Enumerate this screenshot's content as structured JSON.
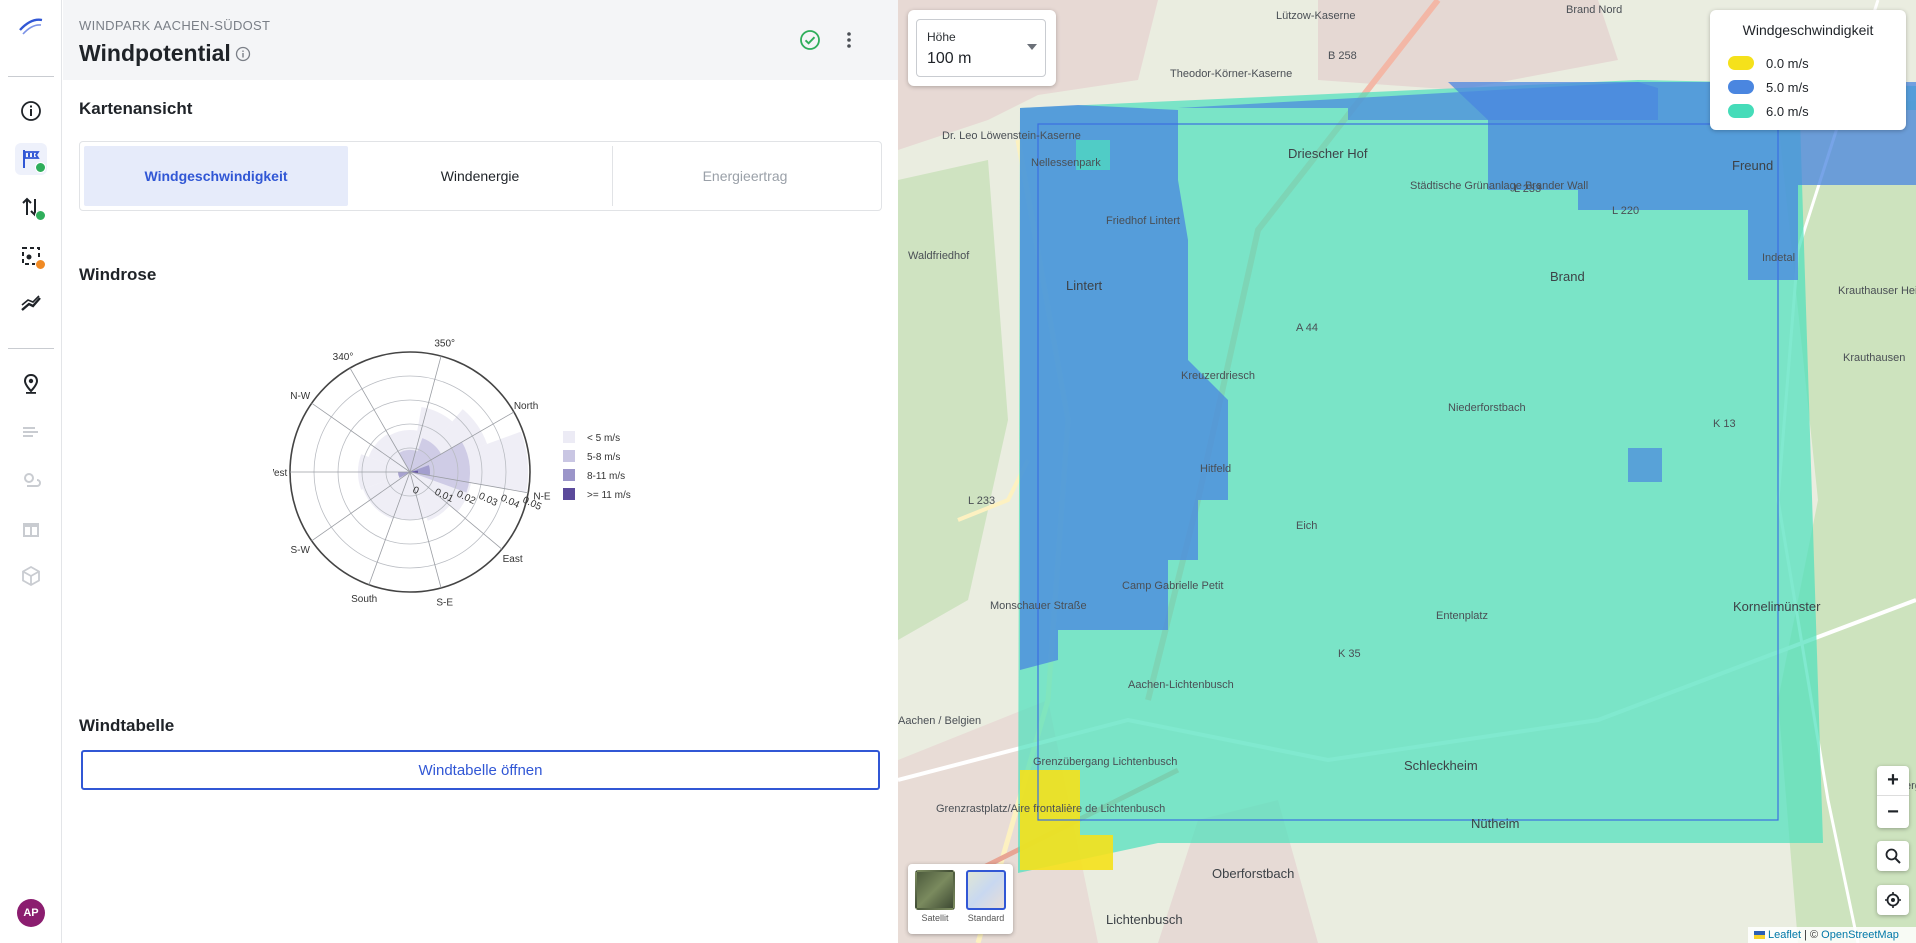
{
  "header": {
    "project_name": "WINDPARK AACHEN-SÜDOST",
    "title": "Windpotential"
  },
  "sidebar": {
    "avatar_initials": "AP",
    "items": [
      {
        "icon": "info-icon"
      },
      {
        "icon": "wind-flag-icon",
        "badge": "green",
        "active": true
      },
      {
        "icon": "turbine-transfer-icon",
        "badge": "green"
      },
      {
        "icon": "area-select-icon",
        "badge": "orange"
      },
      {
        "icon": "transmission-icon"
      },
      {
        "icon": "location-pin-icon"
      },
      {
        "icon": "wind-lines-icon",
        "disabled": true
      },
      {
        "icon": "sun-cloud-icon",
        "disabled": true
      },
      {
        "icon": "gift-icon",
        "disabled": true
      },
      {
        "icon": "cube-icon",
        "disabled": true
      }
    ]
  },
  "kartenansicht": {
    "title": "Kartenansicht",
    "tabs": [
      {
        "label": "Windgeschwindigkeit",
        "state": "active"
      },
      {
        "label": "Windenergie",
        "state": "normal"
      },
      {
        "label": "Energieertrag",
        "state": "disabled"
      }
    ]
  },
  "windrose": {
    "title": "Windrose",
    "direction_labels": [
      "340°",
      "350°",
      "North",
      "N-E",
      "East",
      "S-E",
      "South",
      "S-W",
      "West",
      "N-W"
    ],
    "radial_ticks": [
      "0",
      "0.01",
      "0.02",
      "0.03",
      "0.04",
      "0.05"
    ],
    "legend": [
      "< 5 m/s",
      "5-8 m/s",
      "8-11 m/s",
      ">= 11 m/s"
    ],
    "legend_colors": [
      "#ecebf5",
      "#c9c6e3",
      "#9b95c9",
      "#5b4a9b"
    ]
  },
  "windtabelle": {
    "title": "Windtabelle",
    "button_label": "Windtabelle öffnen"
  },
  "map": {
    "height_label": "Höhe",
    "height_value": "100 m",
    "legend_title": "Windgeschwindigkeit",
    "legend_items": [
      {
        "label": "0.0 m/s",
        "color": "#f5e11b"
      },
      {
        "label": "5.0 m/s",
        "color": "#4a86e0"
      },
      {
        "label": "6.0 m/s",
        "color": "#45dcb9"
      }
    ],
    "layer_satellite": "Satellit",
    "layer_standard": "Standard",
    "zoom_in": "+",
    "zoom_out": "−",
    "attribution_leaflet": "Leaflet",
    "attribution_sep": " | © ",
    "attribution_osm": "OpenStreetMap",
    "places": [
      "Driescher Hof",
      "Brand",
      "Lintert",
      "Kreuzerdriesch",
      "Hitfeld",
      "Niederforstbach",
      "Eich",
      "Entenplatz",
      "Kornelimünster",
      "Schleckheim",
      "Nütheim",
      "Oberforstbach",
      "Lichtenbusch",
      "Freund",
      "Krauthauser Heide",
      "Krauthausen",
      "Nellessenpark",
      "Friedhof Lintert",
      "Waldfriedhof",
      "Dr. Leo Löwenstein-Kaserne",
      "Theodor-Körner-Kaserne",
      "Lützow-Kaserne",
      "Brand Nord",
      "Aachen-Lichtenbusch",
      "Grenzübergang Lichtenbusch",
      "Grenzrastplatz/Aire frontalière de Lichtenbusch",
      "Camp Gabrielle Petit",
      "Indetal",
      "Iterberg",
      "Städtische Grünanlage Brander Wall",
      "Aachen / Belgien",
      "Monschauer Straße"
    ],
    "road_refs": [
      "B 258",
      "L 233",
      "L 220",
      "A 44",
      "K 13",
      "K 35",
      "L 233"
    ]
  }
}
